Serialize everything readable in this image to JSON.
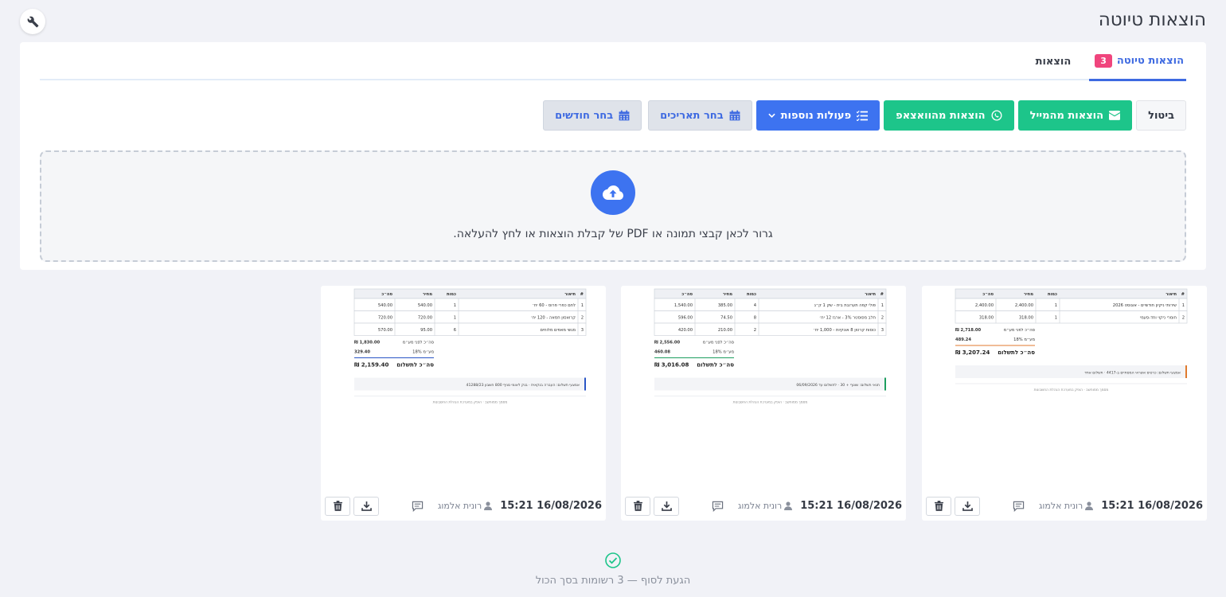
{
  "header": {
    "title": "הוצאות טיוטה",
    "settings_icon": "wrench-icon"
  },
  "tabs": [
    {
      "label": "הוצאות טיוטה",
      "count": "3",
      "active": true
    },
    {
      "label": "הוצאות",
      "active": false
    }
  ],
  "toolbar": {
    "cancel": "ביטול",
    "from_email": "הוצאות מהמייל",
    "from_whatsapp": "הוצאות מהוואצאפ",
    "more_actions": "פעולות נוספות",
    "select_dates": "בחר תאריכים",
    "select_months": "בחר חודשים",
    "icons": [
      "envelope-icon",
      "whatsapp-icon",
      "list-icon",
      "chevron-down-icon",
      "calendar-icon"
    ]
  },
  "dropzone": {
    "text": "גרור לכאן קבצי תמונה או PDF של קבלת הוצאות או לחץ להעלאה.",
    "icon": "cloud-upload-icon"
  },
  "documents": [
    {
      "date": "16/08/2026 15:21",
      "user": "רונית אלמוג",
      "preview": {
        "headers": [
          "#",
          "תיאור",
          "כמות",
          "מחיר",
          "סה״כ"
        ],
        "rows": [
          [
            "1",
            "שירותי ניקיון חודשיים - אוגוסט 2026",
            "1",
            "2,400.00",
            "2,400.00"
          ],
          [
            "2",
            "חומרי ניקוי וחד-פעמי",
            "1",
            "318.00",
            "318.00"
          ]
        ],
        "totals": [
          {
            "label": "סה״כ לפני מע״מ",
            "value": "₪ 2,718.00"
          },
          {
            "label": "מע״מ 18%",
            "value": "489.24"
          }
        ],
        "grand": {
          "label": "סה״כ לתשלום",
          "value": "₪ 3,207.24"
        },
        "note": "אמצעי תשלום: כרטיס אשראי המסתיים ב-4417 · תשלום אחד",
        "footer": "מסמך ממוחשב · הופק במערכת הנהלת החשבונות",
        "accent": "#e07a2e"
      }
    },
    {
      "date": "16/08/2026 15:21",
      "user": "רונית אלמוג",
      "preview": {
        "headers": [
          "#",
          "תיאור",
          "כמות",
          "מחיר",
          "סה״כ"
        ],
        "rows": [
          [
            "1",
            "פולי קפה תערובת בית - שק 1 ק״ג",
            "4",
            "385.00",
            "1,540.00"
          ],
          [
            "2",
            "חלב מפוסטר 3% - ארגז 12 יח׳",
            "8",
            "74.50",
            "596.00"
          ],
          [
            "3",
            "כוסות קרטון 8 אונקיות - 1,000 יח׳",
            "2",
            "210.00",
            "420.00"
          ]
        ],
        "totals": [
          {
            "label": "סה״כ לפני מע״מ",
            "value": "₪ 2,556.00"
          },
          {
            "label": "מע״מ 18%",
            "value": "460.08"
          }
        ],
        "grand": {
          "label": "סה״כ לתשלום",
          "value": "₪ 3,016.08"
        },
        "note": "תנאי תשלום: שוטף + 30 · לתשלום עד 06/09/2026",
        "footer": "מסמך ממוחשב · הופק במערכת הנהלת החשבונות",
        "accent": "#1d9e5f"
      }
    },
    {
      "date": "16/08/2026 15:21",
      "user": "רונית אלמוג",
      "preview": {
        "headers": [
          "#",
          "תיאור",
          "כמות",
          "מחיר",
          "סה״כ"
        ],
        "rows": [
          [
            "1",
            "לחם כפרי פרוס - 60 יח׳",
            "1",
            "540.00",
            "540.00"
          ],
          [
            "2",
            "קרואסון חמאה - 120 יח׳",
            "1",
            "720.00",
            "720.00"
          ],
          [
            "3",
            "מגשי מאפים מלוחים",
            "6",
            "95.00",
            "570.00"
          ]
        ],
        "totals": [
          {
            "label": "סה״כ לפני מע״מ",
            "value": "₪ 1,830.00"
          },
          {
            "label": "מע״מ 18%",
            "value": "329.40"
          }
        ],
        "grand": {
          "label": "סה״כ לתשלום",
          "value": "₪ 2,159.40"
        },
        "note": "אמצעי תשלום: העברה בנקאית · בנק לאומי סניף 800 חשבון 41288/23",
        "footer": "מסמך ממוחשב · הופק במערכת הנהלת החשבונות",
        "accent": "#2a56c6"
      }
    }
  ],
  "end_message": "הגעת לסוף — 3 רשומות בסך הכול",
  "colors": {
    "primary": "#3d73f0",
    "green": "#1dc58a",
    "badge": "#f0457d"
  }
}
